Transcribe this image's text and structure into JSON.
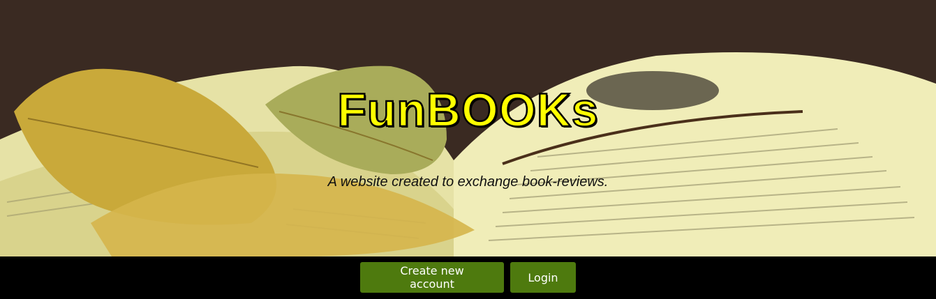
{
  "hero": {
    "title": "FunBOOKs",
    "subtitle": "A website created to exchange book-reviews."
  },
  "actions": {
    "create_account_label": "Create new account",
    "login_label": "Login"
  },
  "colors": {
    "title_fill": "#ffff00",
    "button_bg": "#4e7a0e",
    "footer_bar": "#000000"
  }
}
